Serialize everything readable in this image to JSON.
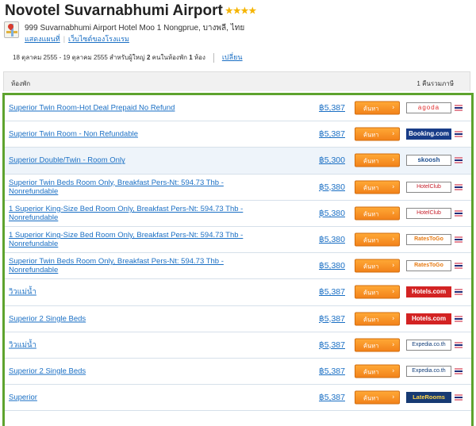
{
  "hotel": {
    "name": "Novotel Suvarnabhumi Airport",
    "stars": "★★★★",
    "address": "999 Suvarnabhumi Airport Hotel Moo 1 Nongprue, บางพลี, ไทย",
    "links": {
      "show_map": "แสดงแผนที่",
      "visit_site": "เว็บไซต์ของโรงแรม"
    }
  },
  "search": {
    "summary_prefix": "18 ตุลาคม 2555 - 19 ตุลาคม 2555 สำหรับผู้ใหญ่ ",
    "adults": "2",
    "summary_mid": " คนในห้องพัก ",
    "rooms": "1",
    "summary_suffix": " ห้อง",
    "change_label": "เปลี่ยน"
  },
  "list_header": {
    "room_col": "ห้องพัก",
    "price_col": "1 คืนรวมภาษี"
  },
  "book_label": "ค้นหา",
  "rows": [
    {
      "name": "Superior Twin Room-Hot Deal Prepaid No Refund",
      "price": "฿5,387",
      "provider": "agoda",
      "provider_icon": "agoda-logo"
    },
    {
      "name": "Superior Twin Room - Non Refundable",
      "price": "฿5,387",
      "provider": "Booking.com",
      "provider_icon": "booking-logo"
    },
    {
      "name": "Superior Double/Twin - Room Only",
      "price": "฿5,300",
      "provider": "skoosh",
      "provider_icon": "skoosh-logo"
    },
    {
      "name": "Superior Twin Beds Room Only, Breakfast Pers-Nt: 594.73 Thb - Nonrefundable",
      "price": "฿5,380",
      "provider": "HotelClub",
      "provider_icon": "hotelclub-logo"
    },
    {
      "name": "1 Superior King-Size Bed Room Only, Breakfast Pers-Nt: 594.73 Thb - Nonrefundable",
      "price": "฿5,380",
      "provider": "HotelClub",
      "provider_icon": "hotelclub-logo"
    },
    {
      "name": "1 Superior King-Size Bed Room Only, Breakfast Pers-Nt: 594.73 Thb - Nonrefundable",
      "price": "฿5,380",
      "provider": "RatesToGo",
      "provider_icon": "ratestogo-logo"
    },
    {
      "name": "Superior Twin Beds Room Only, Breakfast Pers-Nt: 594.73 Thb - Nonrefundable",
      "price": "฿5,380",
      "provider": "RatesToGo",
      "provider_icon": "ratestogo-logo"
    },
    {
      "name": "วิวแม่น้ำ",
      "price": "฿5,387",
      "provider": "Hotels.com",
      "provider_icon": "hotelscom-logo"
    },
    {
      "name": "Superior 2 Single Beds",
      "price": "฿5,387",
      "provider": "Hotels.com",
      "provider_icon": "hotelscom-logo"
    },
    {
      "name": "วิวแม่น้ำ",
      "price": "฿5,387",
      "provider": "Expedia.co.th",
      "provider_icon": "expedia-logo"
    },
    {
      "name": "Superior 2 Single Beds",
      "price": "฿5,387",
      "provider": "Expedia.co.th",
      "provider_icon": "expedia-logo"
    },
    {
      "name": "Superior",
      "price": "฿5,387",
      "provider": "LateRooms",
      "provider_icon": "laterooms-logo"
    }
  ],
  "colors": {
    "accent_green": "#5ea32e",
    "link_blue": "#1a6fc4",
    "button_orange": "#f2821a"
  }
}
